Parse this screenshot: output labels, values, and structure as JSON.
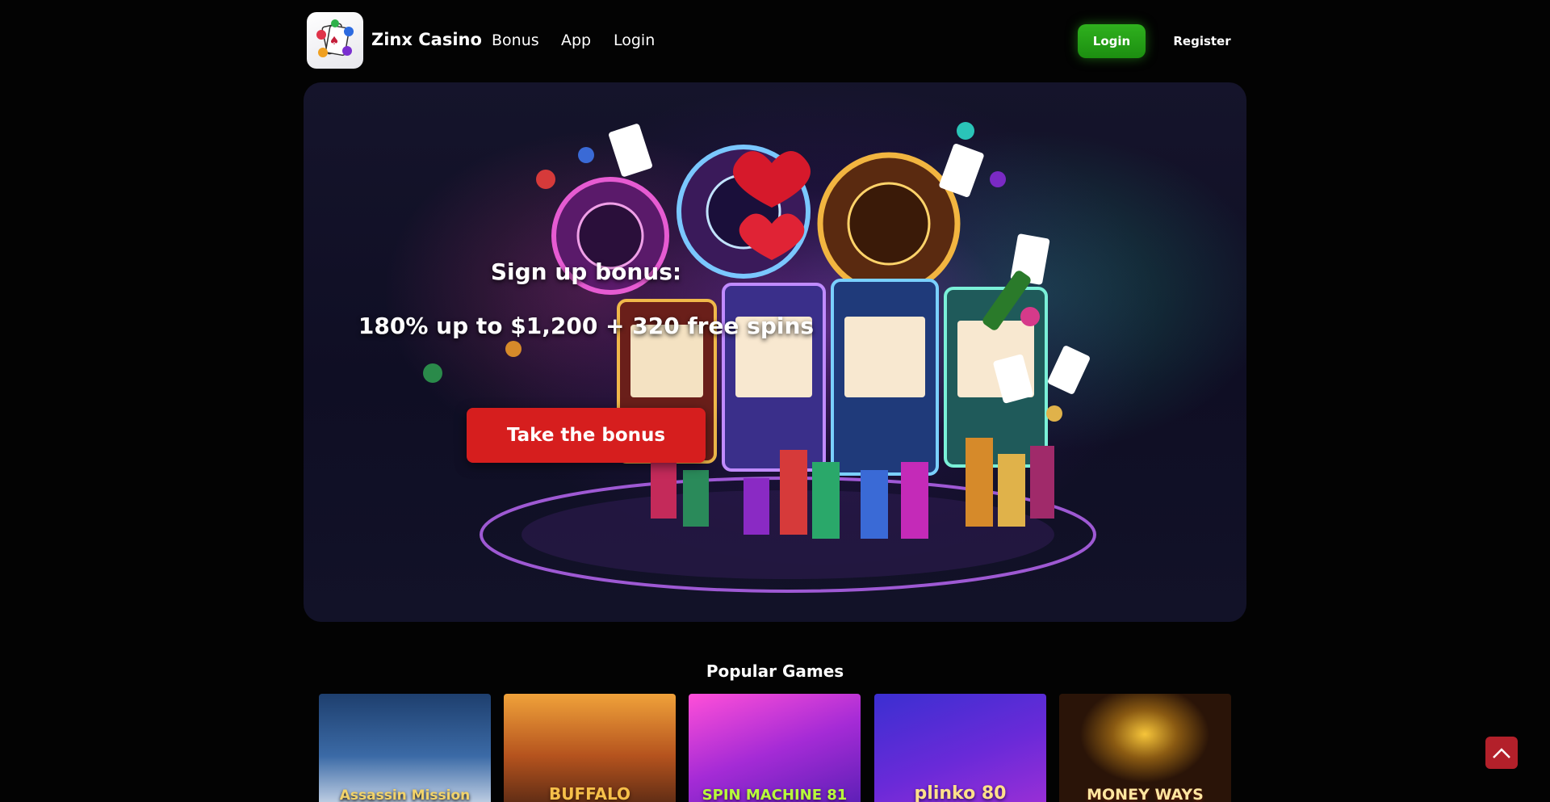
{
  "header": {
    "site_name": "Zinx Casino",
    "nav": {
      "bonus": "Bonus",
      "app": "App",
      "login": "Login"
    },
    "login_button": "Login",
    "register_button": "Register",
    "login_button_color": "#23a116"
  },
  "hero": {
    "title_line1": "Sign up bonus:",
    "title_line2": "180% up to $1,200 + 320 free spins",
    "cta": "Take the bonus",
    "cta_color": "#d61e1e"
  },
  "popular": {
    "title": "Popular Games",
    "games": [
      {
        "name": "Assassin Mission"
      },
      {
        "name": "BUFFALO"
      },
      {
        "name": "SPIN MACHINE 81"
      },
      {
        "name": "plinko 80"
      },
      {
        "name": "MONEY WAYS"
      }
    ]
  },
  "icons": {
    "logo": "casino-logo-icon",
    "scroll_top": "chevron-up-icon"
  }
}
